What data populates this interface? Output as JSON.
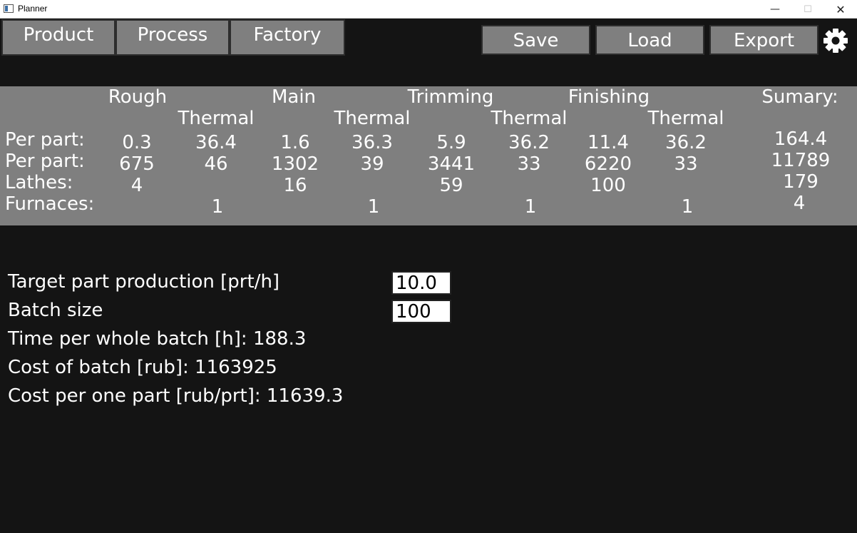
{
  "window": {
    "title": "Planner",
    "minimize": "—",
    "maximize": "☐",
    "close": "✕"
  },
  "nav": {
    "product": "Product",
    "process": "Process",
    "factory": "Factory"
  },
  "toolbar": {
    "save": "Save",
    "load": "Load",
    "export": "Export",
    "settings_icon": "gear-icon"
  },
  "summary": {
    "stages": [
      "Rough",
      "Main",
      "Trimming",
      "Finishing"
    ],
    "thermal": [
      "Thermal",
      "Thermal",
      "Thermal",
      "Thermal"
    ],
    "summary_header": "Sumary:",
    "row_labels": [
      "Per part:",
      "Per part:",
      "Lathes:",
      "Furnaces:"
    ],
    "rows": [
      [
        "0.3",
        "36.4",
        "1.6",
        "36.3",
        "5.9",
        "36.2",
        "11.4",
        "36.2"
      ],
      [
        "675",
        "46",
        "1302",
        "39",
        "3441",
        "33",
        "6220",
        "33"
      ],
      [
        "4",
        "",
        "16",
        "",
        "59",
        "",
        "100",
        ""
      ],
      [
        "",
        "1",
        "",
        "1",
        "",
        "1",
        "",
        "1"
      ]
    ],
    "totals": [
      "164.4",
      "11789",
      "179",
      "4"
    ]
  },
  "form": {
    "target_label": "Target part production [prt/h]",
    "target_value": "10.0",
    "batch_label": "Batch size",
    "batch_value": "100",
    "time_text": "Time per whole batch [h]: 188.3",
    "cost_batch_text": "Cost of batch [rub]: 1163925",
    "cost_part_text": "Cost per one part [rub/prt]: 11639.3"
  },
  "colors": {
    "background": "#141414",
    "panel": "#7f7f7f",
    "text": "#ffffff"
  }
}
